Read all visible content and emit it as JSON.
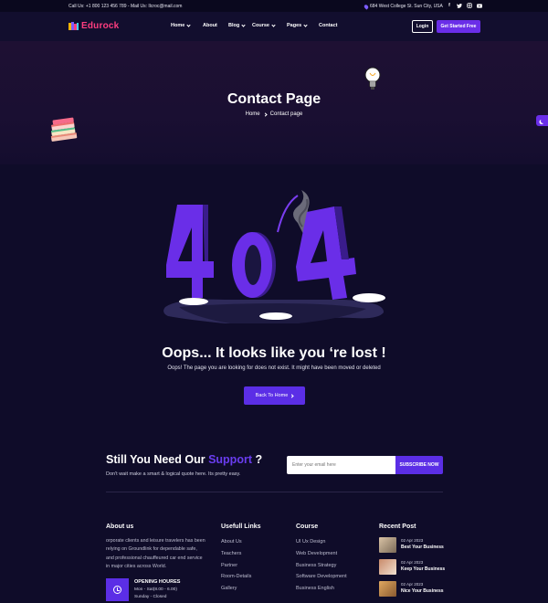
{
  "topbar": {
    "contact": "Call Us: +1 800 123 456 789 - Mail Us: Ilcroc@mail.com",
    "address": "684 West College St. Sun City, USA",
    "social": [
      "f",
      "t",
      "in",
      "yt"
    ]
  },
  "brand": {
    "name": "Edurock",
    "color": "#ff3d7f"
  },
  "nav": {
    "items": [
      {
        "label": "Home",
        "caret": true
      },
      {
        "label": "About",
        "caret": false
      },
      {
        "label": "Blog",
        "caret": true
      },
      {
        "label": "Course",
        "caret": true
      },
      {
        "label": "Pages",
        "caret": true
      },
      {
        "label": "Contact",
        "caret": false
      }
    ],
    "login": "Login",
    "cta": "Get Started Free"
  },
  "hero": {
    "title": "Contact Page",
    "breadcrumb": [
      "Home",
      "Contact page"
    ]
  },
  "error": {
    "title": "Oops... It looks like you ‘re lost !",
    "subtitle": "Oops! The page you are looking for does not exist. It might have been moved or deleted",
    "button": "Back To Home"
  },
  "newsletter": {
    "title_plain": "Still You Need Our",
    "title_highlight": "Support",
    "title_end": "?",
    "subtitle": "Don't wait make a smart & logical quote here. Its pretty easy.",
    "placeholder": "Enter your email here",
    "button": "SUBSCRIBE NOW"
  },
  "footer": {
    "about": {
      "title": "About us",
      "text": "orporate clients and leisure travelers has been relying on Groundlink for dependable safe, and professional chauffeured car end service in major cities across World.",
      "hours_title": "OPENING HOURES",
      "hours_lines": [
        "Mon - Sat(8.00 - 6.00)",
        "Sunday - Closed"
      ]
    },
    "useful_links": {
      "title": "Usefull Links",
      "items": [
        "About Us",
        "Teachers",
        "Partner",
        "Room-Details",
        "Gallery"
      ]
    },
    "course": {
      "title": "Course",
      "items": [
        "UI Ux Design",
        "Web Development",
        "Business Strategy",
        "Software Development",
        "Business English"
      ]
    },
    "recent_posts": {
      "title": "Recent Post",
      "items": [
        {
          "date": "02 Apr 2023",
          "title": "Best Your Business"
        },
        {
          "date": "02 Apr 2023",
          "title": "Keep Your Business"
        },
        {
          "date": "02 Apr 2023",
          "title": "Nice Your Business"
        }
      ]
    }
  },
  "colors": {
    "background": "#0f0c29",
    "accent": "#5b2ee6",
    "highlight": "#6a3df0"
  }
}
